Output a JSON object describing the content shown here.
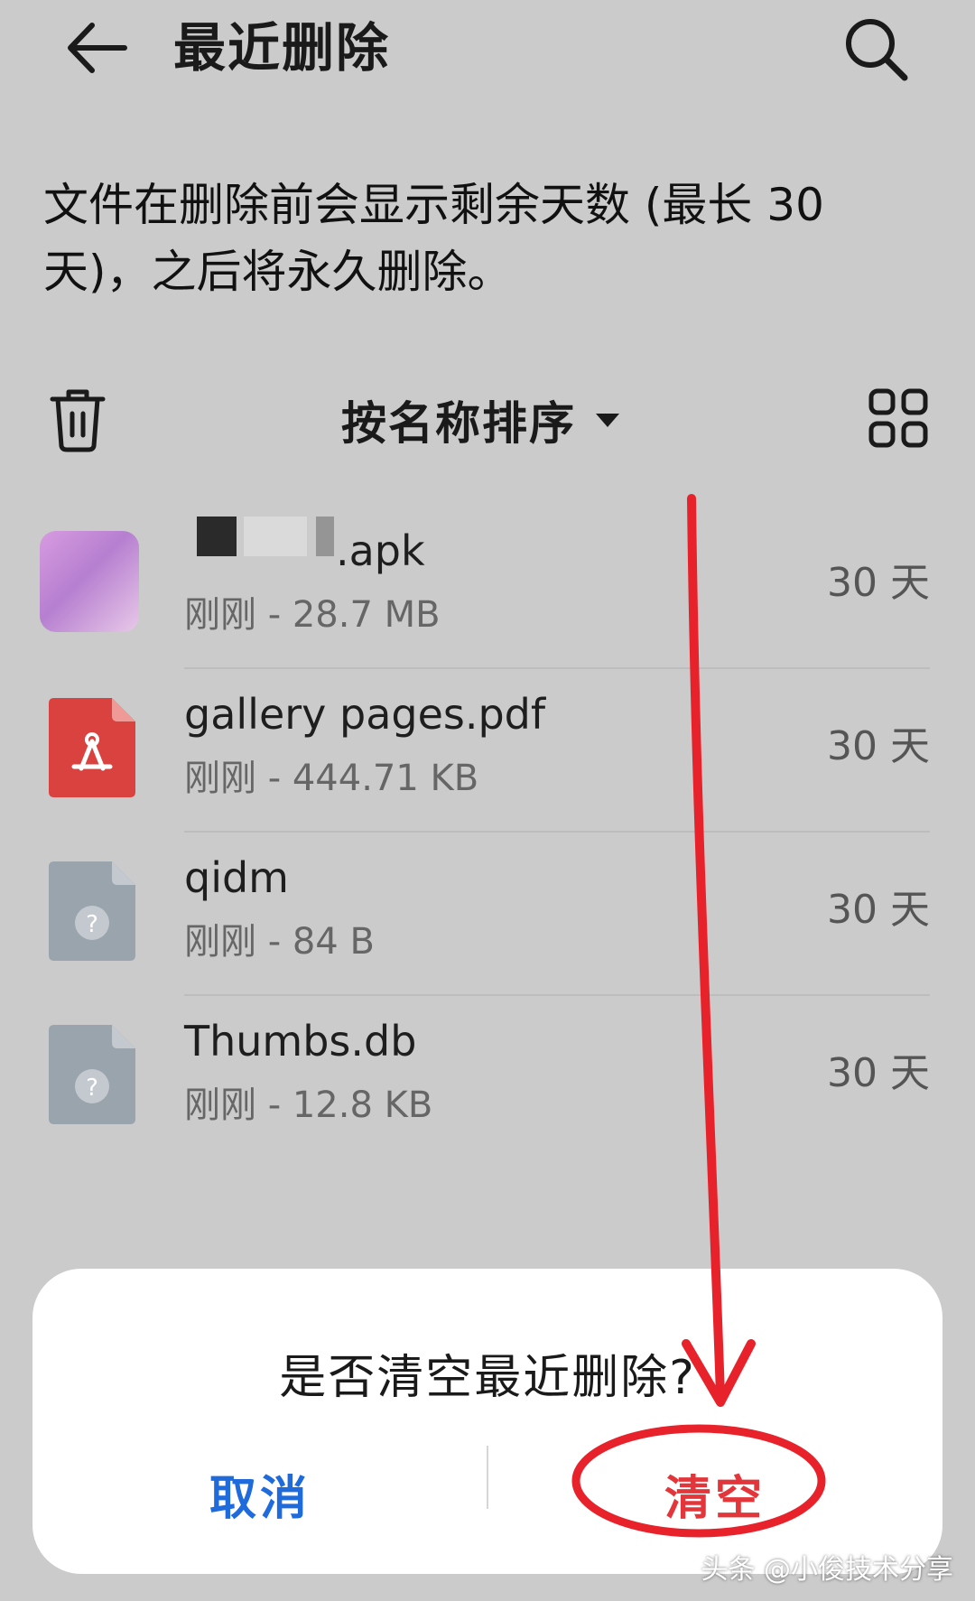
{
  "header": {
    "title": "最近删除",
    "back_icon": "back-arrow-icon",
    "search_icon": "search-icon"
  },
  "info": {
    "text": "文件在删除前会显示剩余天数 (最长 30 天)，之后将永久删除。"
  },
  "toolbar": {
    "trash_icon": "trash-icon",
    "sort_label": "按名称排序",
    "grid_icon": "grid-view-icon"
  },
  "files": [
    {
      "name": ".apk",
      "meta": "刚刚 - 28.7 MB",
      "days": "30 天",
      "icon": "app-thumbnail"
    },
    {
      "name": "gallery pages.pdf",
      "meta": "刚刚 - 444.71 KB",
      "days": "30 天",
      "icon": "pdf-file-icon"
    },
    {
      "name": "qidm",
      "meta": "刚刚 - 84 B",
      "days": "30 天",
      "icon": "unknown-file-icon"
    },
    {
      "name": "Thumbs.db",
      "meta": "刚刚 - 12.8 KB",
      "days": "30 天",
      "icon": "unknown-file-icon"
    }
  ],
  "dialog": {
    "title": "是否清空最近删除?",
    "cancel_label": "取消",
    "confirm_label": "清空"
  },
  "colors": {
    "background": "#cbcbcb",
    "cancel": "#1f6bdc",
    "confirm": "#e3363a",
    "annotation": "#e8222a",
    "pdf": "#d9423f",
    "unknown_file": "#9aa4ad"
  },
  "watermark": "头条 @小俊技术分享"
}
